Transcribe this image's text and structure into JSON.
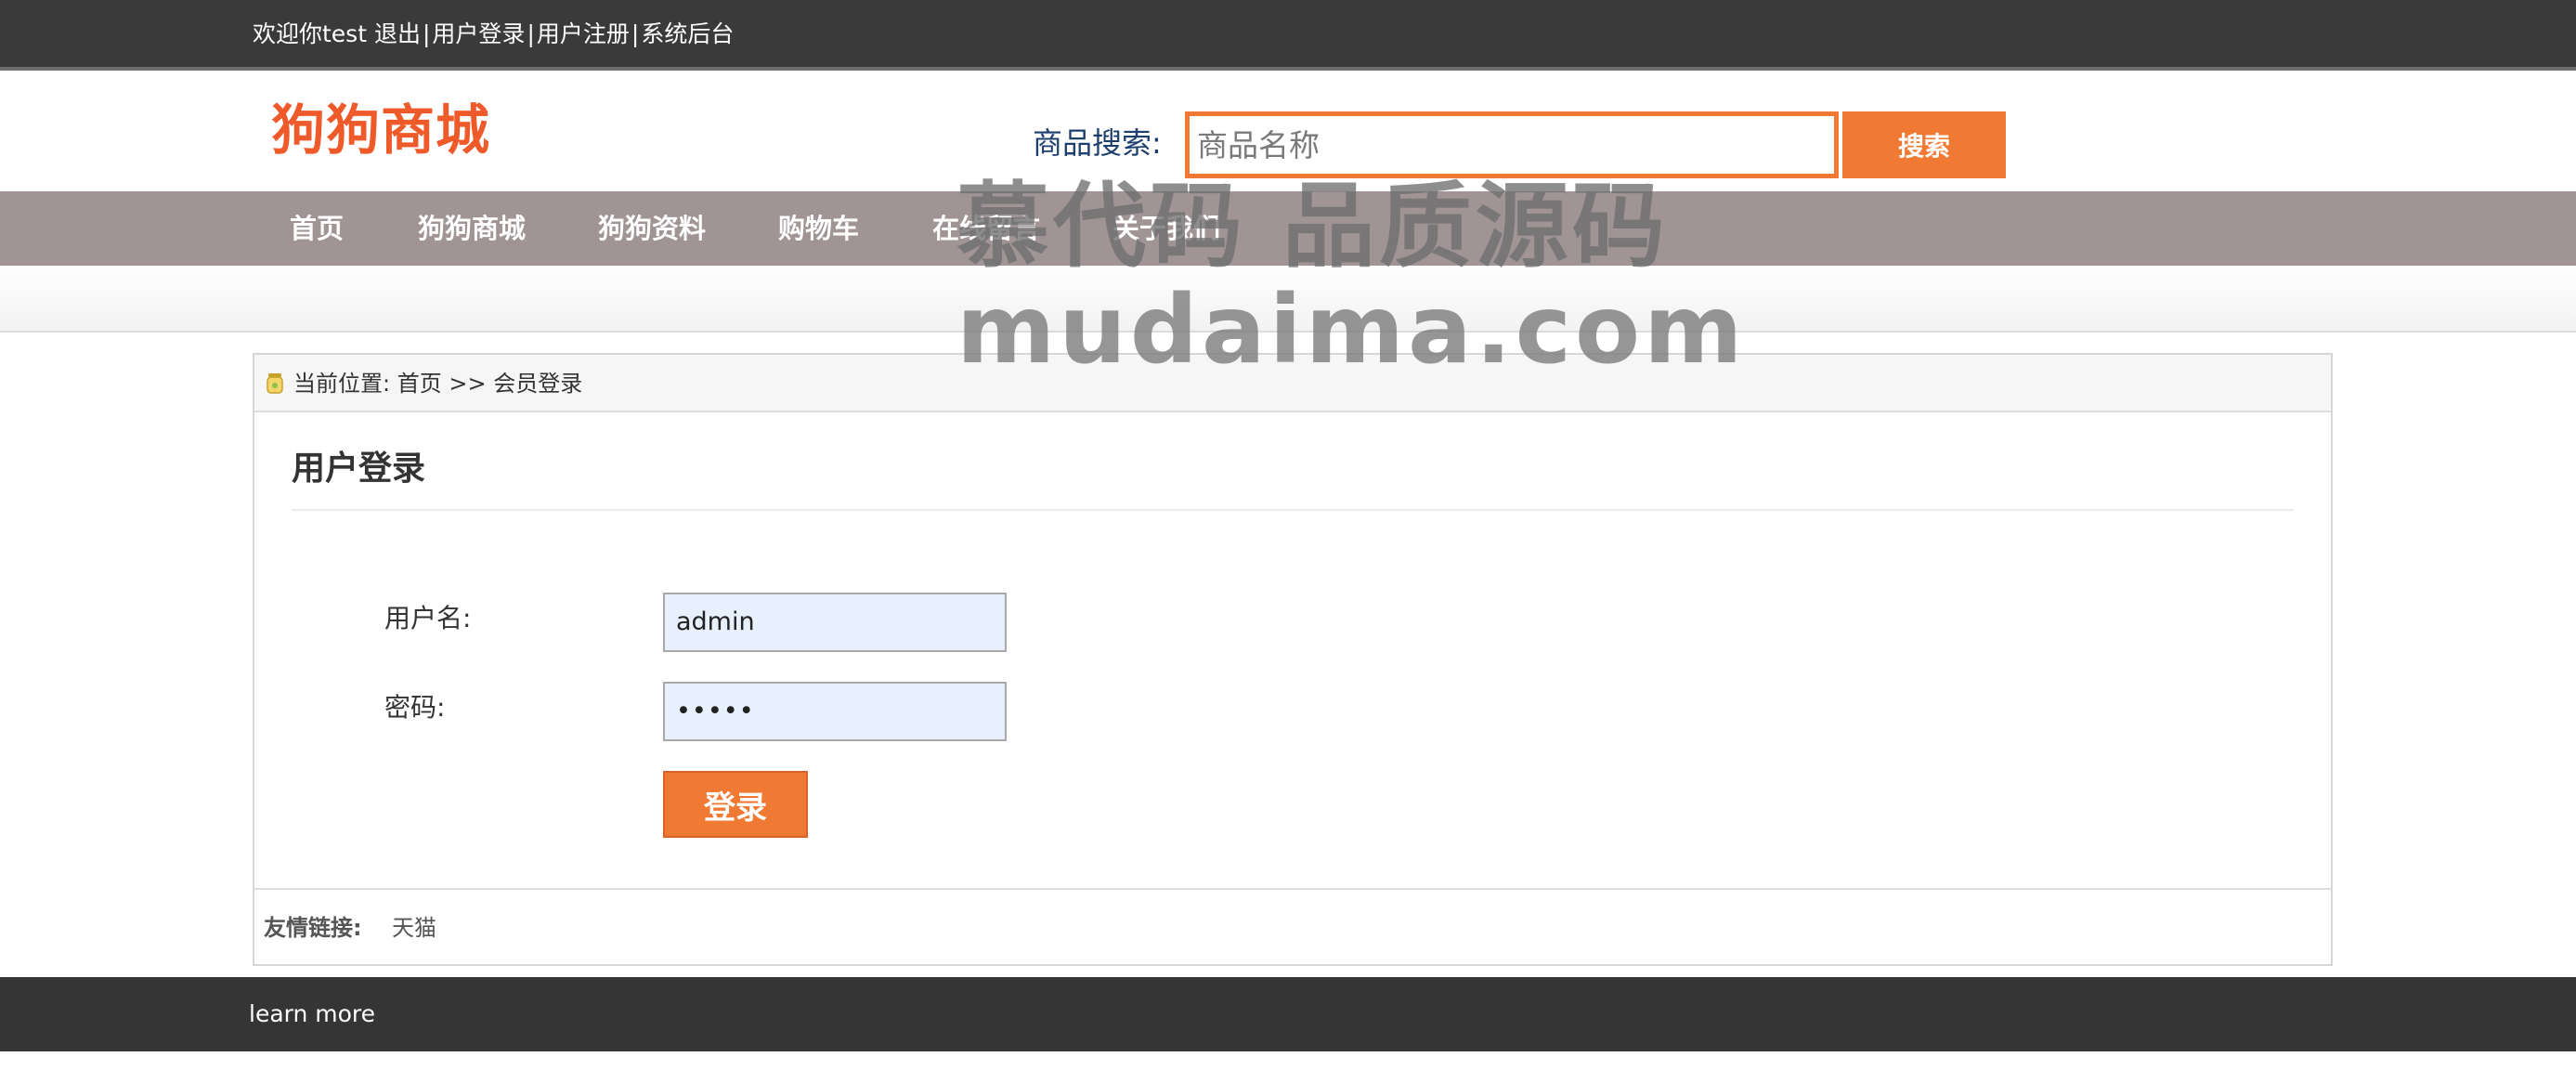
{
  "topbar": {
    "welcome": "欢迎你test",
    "logout": "退出",
    "sep1": "|",
    "login": "用户登录",
    "sep2": "|",
    "register": "用户注册",
    "sep3": "|",
    "admin": "系统后台"
  },
  "header": {
    "logo": "狗狗商城",
    "search_label": "商品搜索:",
    "search_placeholder": "商品名称",
    "search_button": "搜索"
  },
  "nav": {
    "items": [
      {
        "label": "首页"
      },
      {
        "label": "狗狗商城"
      },
      {
        "label": "狗狗资料"
      },
      {
        "label": "购物车"
      },
      {
        "label": "在线留言"
      },
      {
        "label": "关于我们"
      }
    ]
  },
  "breadcrumb": {
    "prefix": "当前位置:",
    "home": "首页",
    "sep": ">>",
    "current": "会员登录"
  },
  "login": {
    "title": "用户登录",
    "username_label": "用户名:",
    "username_value": "admin",
    "password_label": "密码:",
    "password_value": "•••••",
    "submit": "登录"
  },
  "links": {
    "label": "友情链接:",
    "items": [
      "天猫"
    ]
  },
  "footer": {
    "text": "learn more"
  },
  "watermark": {
    "line1": "慕代码 品质源码",
    "line2": "mudaima.com"
  },
  "colors": {
    "accent": "#f07a33",
    "logo": "#ee5a2a",
    "nav_bg": "#a09495",
    "topbar_bg": "#3a3a3a",
    "footer_bg": "#353535"
  }
}
